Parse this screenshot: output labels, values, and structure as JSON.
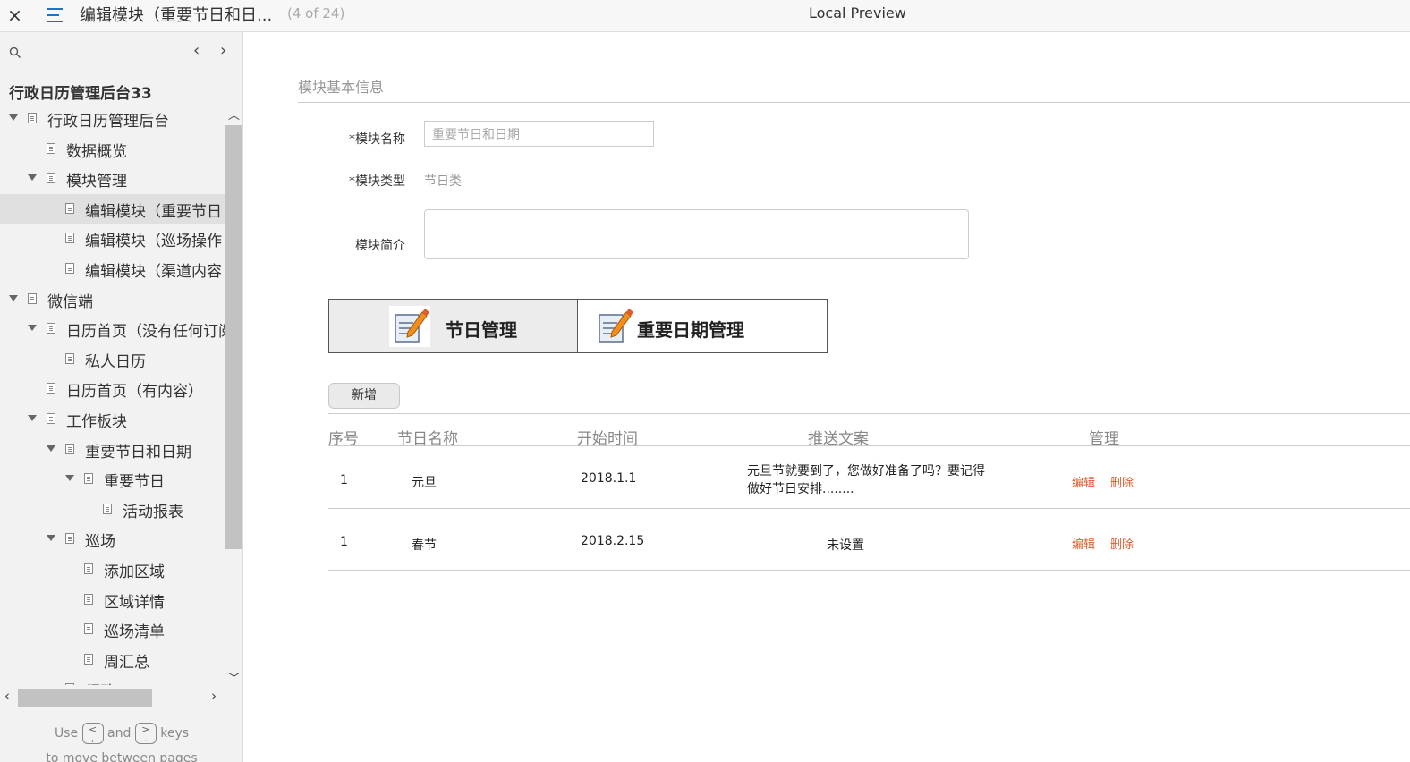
{
  "topbar": {
    "close_label": "×",
    "title": "编辑模块（重要节日和日...",
    "page_count": "(4 of 24)",
    "preview_label": "Local Preview"
  },
  "sidebar": {
    "nav_prev": "‹",
    "nav_next": "›",
    "project_title": "行政日历管理后台33",
    "tree": [
      {
        "label": "行政日历管理后台",
        "depth": 0,
        "caret": true,
        "selected": false
      },
      {
        "label": "数据概览",
        "depth": 1,
        "caret": false,
        "selected": false
      },
      {
        "label": "模块管理",
        "depth": 1,
        "caret": true,
        "selected": false
      },
      {
        "label": "编辑模块（重要节日",
        "depth": 2,
        "caret": false,
        "selected": true
      },
      {
        "label": "编辑模块（巡场操作",
        "depth": 2,
        "caret": false,
        "selected": false
      },
      {
        "label": "编辑模块（渠道内容",
        "depth": 2,
        "caret": false,
        "selected": false
      },
      {
        "label": "微信端",
        "depth": 0,
        "caret": true,
        "selected": false
      },
      {
        "label": "日历首页（没有任何订阅",
        "depth": 1,
        "caret": true,
        "selected": false
      },
      {
        "label": "私人日历",
        "depth": 2,
        "caret": false,
        "selected": false
      },
      {
        "label": "日历首页（有内容）",
        "depth": 1,
        "caret": false,
        "selected": false
      },
      {
        "label": "工作板块",
        "depth": 1,
        "caret": true,
        "selected": false
      },
      {
        "label": "重要节日和日期",
        "depth": 2,
        "caret": true,
        "selected": false
      },
      {
        "label": "重要节日",
        "depth": 3,
        "caret": true,
        "selected": false
      },
      {
        "label": "活动报表",
        "depth": 4,
        "caret": false,
        "selected": false
      },
      {
        "label": "巡场",
        "depth": 2,
        "caret": true,
        "selected": false
      },
      {
        "label": "添加区域",
        "depth": 3,
        "caret": false,
        "selected": false
      },
      {
        "label": "区域详情",
        "depth": 3,
        "caret": false,
        "selected": false
      },
      {
        "label": "巡场清单",
        "depth": 3,
        "caret": false,
        "selected": false
      },
      {
        "label": "周汇总",
        "depth": 3,
        "caret": false,
        "selected": false
      },
      {
        "label": "行政",
        "depth": 2,
        "caret": true,
        "selected": false
      }
    ],
    "hint": {
      "use": "Use",
      "key_prev": "<",
      "key_prev_alt": ",",
      "and": "and",
      "key_next": ">",
      "key_next_alt": ".",
      "keys": "keys",
      "line2": "to move between pages"
    }
  },
  "main": {
    "section_title": "模块基本信息",
    "form": {
      "name_label": "*模块名称",
      "name_value": "重要节日和日期",
      "type_label": "*模块类型",
      "type_value": "节日类",
      "intro_label": "模块简介"
    },
    "tabs": [
      {
        "label": "节日管理",
        "icon": "edit-document-icon",
        "active": true
      },
      {
        "label": "重要日期管理",
        "icon": "edit-document-icon",
        "active": false
      }
    ],
    "add_button": "新增",
    "table": {
      "headers": [
        "序号",
        "节日名称",
        "开始时间",
        "推送文案",
        "管理"
      ],
      "rows": [
        {
          "index": "1",
          "name": "元旦",
          "start": "2018.1.1",
          "push": "元旦节就要到了，您做好准备了吗？要记得做好节日安排........",
          "edit": "编辑",
          "delete": "删除"
        },
        {
          "index": "1",
          "name": "春节",
          "start": "2018.2.15",
          "push": "未设置",
          "edit": "编辑",
          "delete": "删除"
        }
      ]
    }
  },
  "colors": {
    "accent": "#1a73c9",
    "action": "#e05a2b",
    "sidebar_bg": "#f2f2f2"
  }
}
